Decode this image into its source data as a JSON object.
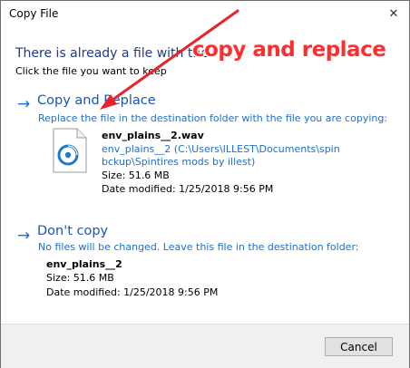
{
  "window": {
    "title": "Copy File",
    "close_glyph": "✕"
  },
  "header": {
    "heading": "There is already a file with the",
    "subheading": "Click the file you want to keep"
  },
  "annotation": {
    "text": "copy and replace",
    "color": "#ff2e2e"
  },
  "options": {
    "replace": {
      "arrow": "→",
      "title": "Copy and Replace",
      "description": "Replace the file in the destination folder with the file you are copying:",
      "file": {
        "icon": "audio-file-icon",
        "name": "env_plains__2.wav",
        "path_line1": "env_plains__2 (C:\\Users\\ILLEST\\Documents\\spin",
        "path_line2": "bckup\\Spintires mods by illest)",
        "size": "Size: 51.6 MB",
        "modified": "Date modified: 1/25/2018 9:56 PM"
      }
    },
    "dont_copy": {
      "arrow": "→",
      "title": "Don't copy",
      "description": "No files will be changed. Leave this file in the destination folder:",
      "file": {
        "name": "env_plains__2",
        "size": "Size: 51.6 MB",
        "modified": "Date modified: 1/25/2018 9:56 PM"
      }
    }
  },
  "footer": {
    "cancel_label": "Cancel"
  },
  "colors": {
    "link_blue": "#1c6fd1",
    "heading_blue": "#1e3a8a",
    "footer_bg": "#f0f0f0"
  }
}
